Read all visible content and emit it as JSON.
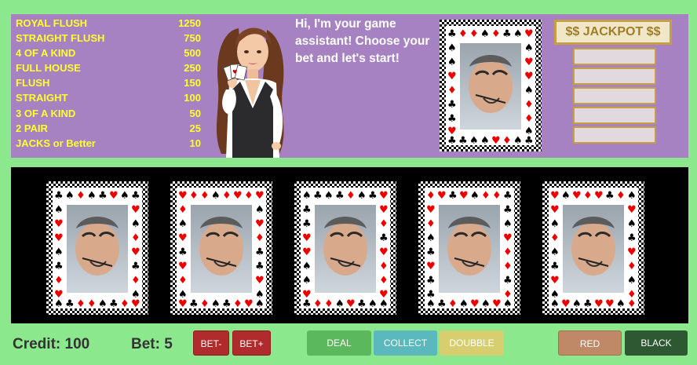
{
  "colors": {
    "background": "#8ce88c",
    "top_panel": "#a782c2",
    "paytable_text": "#ffff2a",
    "card_table": "#000000",
    "jackpot_border": "#c79f42",
    "deal_button": "#5cb85c",
    "collect_button": "#5bb8bd",
    "double_button": "#d7cf6f",
    "red_button": "#bf8866",
    "black_button": "#2e5831",
    "bet_buttons": "#b02b2b"
  },
  "paytable": [
    {
      "hand": "ROYAL FLUSH",
      "payout": "1250"
    },
    {
      "hand": "STRAIGHT FLUSH",
      "payout": "750"
    },
    {
      "hand": "4 OF A KIND",
      "payout": "500"
    },
    {
      "hand": "FULL HOUSE",
      "payout": "250"
    },
    {
      "hand": "FLUSH",
      "payout": "150"
    },
    {
      "hand": "STRAIGHT",
      "payout": "100"
    },
    {
      "hand": "3 OF A KIND",
      "payout": "50"
    },
    {
      "hand": "2 PAIR",
      "payout": "25"
    },
    {
      "hand": "JACKS or Better",
      "payout": "10"
    }
  ],
  "assistant": {
    "message": "Hi, I'm your game assistant! Choose your bet and let's start!",
    "icon": "dealer-avatar-icon"
  },
  "jackpot": {
    "title": "$$ JACKPOT $$",
    "rows": [
      "",
      "",
      "",
      "",
      ""
    ]
  },
  "cards": [
    {
      "state": "face-down",
      "icon": "card-back-icon"
    },
    {
      "state": "face-down",
      "icon": "card-back-icon"
    },
    {
      "state": "face-down",
      "icon": "card-back-icon"
    },
    {
      "state": "face-down",
      "icon": "card-back-icon"
    },
    {
      "state": "face-down",
      "icon": "card-back-icon"
    }
  ],
  "status": {
    "credit": "Credit: 100",
    "bet": "Bet: 5"
  },
  "buttons": {
    "bet_minus": "BET-",
    "bet_plus": "BET+",
    "deal": "DEAL",
    "collect": "COLLECT",
    "double": "DOUBBLE",
    "red": "RED",
    "black": "BLACK"
  }
}
